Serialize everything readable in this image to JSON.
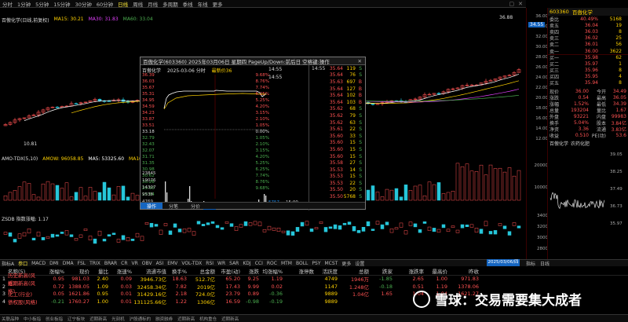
{
  "stock": {
    "code": "603360",
    "name": "百傲化学"
  },
  "topbar": {
    "tabs": [
      "分时",
      "1分钟",
      "5分钟",
      "15分钟",
      "30分钟",
      "60分钟",
      "日线",
      "周线",
      "月线",
      "多周期",
      "季线",
      "年线",
      "更多"
    ],
    "active": "日线"
  },
  "main": {
    "title": "百傲化学(日线,前复权)",
    "ma": {
      "ma15": "MA15: 30.21",
      "ma30": "MA30: 31.83",
      "ma60": "MA60: 33.04"
    },
    "high_label": "36.88",
    "price_tag": "34.55",
    "low_label": "10.81",
    "price_ticks": [
      "36.00",
      "34.00",
      "32.00",
      "30.00",
      "28.00",
      "26.00",
      "24.00",
      "22.00",
      "20.00",
      "18.00",
      "16.00",
      "14.00",
      "12.00"
    ],
    "vol_legend": {
      "name": "AMO-TDX(5,10)",
      "amow": "AMOW: 96058.85",
      "ma5": "MA5: 53325.60",
      "ma10": "MA10: 54237.05"
    },
    "vol_ticks": [
      "20000",
      "10000"
    ],
    "sub_legend": "ZSDB  指数涨幅: 1.17",
    "sub_ticks": [
      "3400",
      "3200",
      "3000",
      "2800"
    ]
  },
  "side": {
    "quotes": [
      {
        "k": "委比",
        "v": "40.49%",
        "n": "委差",
        "nv": "5168"
      },
      {
        "k": "卖五",
        "v": "36.04",
        "n": "",
        "nv": "19"
      },
      {
        "k": "卖四",
        "v": "36.03",
        "n": "",
        "nv": "8"
      },
      {
        "k": "卖三",
        "v": "36.02",
        "n": "",
        "nv": "25"
      },
      {
        "k": "卖二",
        "v": "36.01",
        "n": "",
        "nv": "56"
      },
      {
        "k": "卖一",
        "v": "36.00",
        "n": "",
        "nv": "3622"
      },
      {
        "k": "买一",
        "v": "35.98",
        "n": "",
        "nv": "62"
      },
      {
        "k": "买二",
        "v": "35.97",
        "n": "",
        "nv": "1"
      },
      {
        "k": "买三",
        "v": "35.96",
        "n": "",
        "nv": "8"
      },
      {
        "k": "买四",
        "v": "35.95",
        "n": "",
        "nv": "4"
      },
      {
        "k": "买五",
        "v": "35.94",
        "n": "",
        "nv": "8"
      }
    ],
    "info": [
      {
        "k": "现价",
        "v": "36.00",
        "k2": "今开",
        "v2": "34.49"
      },
      {
        "k": "涨跌",
        "v": "0.54",
        "k2": "最高",
        "v2": "36.05"
      },
      {
        "k": "涨幅",
        "v": "1.52%",
        "k2": "最低",
        "v2": "34.39"
      },
      {
        "k": "总量",
        "v": "193204",
        "k2": "量比",
        "v2": "1.67"
      },
      {
        "k": "外盘",
        "v": "93221",
        "k2": "内盘",
        "v2": "99983"
      },
      {
        "k": "换手",
        "v": "5.04%",
        "k2": "股本",
        "v2": "3.84亿"
      },
      {
        "k": "净资",
        "v": "3.36",
        "k2": "流通",
        "v2": "3.83亿"
      },
      {
        "k": "收益",
        "v": "0.510",
        "k2": "PE(动)",
        "v2": "53.6"
      }
    ],
    "mini_tabs": [
      "百傲化学",
      "农药化肥"
    ],
    "mini_ticks": [
      "39.05",
      "38.25",
      "37.49",
      "36.73",
      "35.97"
    ]
  },
  "popup": {
    "title": "百傲化学(603360)  2025年03月06日 星期四  PageUp/Down:前后日  空格键:操作",
    "sub": {
      "name": "百傲化学",
      "date": "2025-03-06 分时",
      "price": "最新价36"
    },
    "left_ticks": [
      "36.39",
      "36.03",
      "35.67",
      "35.31",
      "34.95",
      "34.59",
      "34.23",
      "33.87",
      "33.51",
      "33.18",
      "32.79",
      "32.43",
      "32.07",
      "31.71",
      "31.35",
      "30.98",
      "30.62",
      "30.26",
      "29.90",
      "29.54"
    ],
    "pct_ticks": [
      "9.68%",
      "8.76%",
      "7.74%",
      "6.25%",
      "5.25%",
      "4.20%",
      "3.15%",
      "2.10%",
      "1.05%",
      "0.00%",
      "1.05%",
      "2.10%",
      "3.15%",
      "4.20%",
      "5.25%",
      "6.25%",
      "7.74%",
      "8.76%",
      "9.68%"
    ],
    "vol_ticks": [
      "23845",
      "19076",
      "14307",
      "9538",
      "4769"
    ],
    "time_labels": [
      "09:30",
      "11:25",
      "13:00",
      "15:00"
    ],
    "cur_time": "14:55",
    "cur_time2": "14:55",
    "trades": [
      {
        "tm": "14:55",
        "pr": "35.64",
        "vv": "119",
        "bs": "S"
      },
      {
        "tm": "",
        "pr": "35.64",
        "vv": "76",
        "bs": "S"
      },
      {
        "tm": "",
        "pr": "35.63",
        "vv": "697",
        "bs": "B"
      },
      {
        "tm": "",
        "pr": "35.64",
        "vv": "127",
        "bs": "B"
      },
      {
        "tm": "",
        "pr": "35.64",
        "vv": "102",
        "bs": "B"
      },
      {
        "tm": "",
        "pr": "35.64",
        "vv": "103",
        "bs": "B"
      },
      {
        "tm": "",
        "pr": "35.62",
        "vv": "68",
        "bs": "S"
      },
      {
        "tm": "",
        "pr": "35.62",
        "vv": "79",
        "bs": "S"
      },
      {
        "tm": "",
        "pr": "35.62",
        "vv": "63",
        "bs": "S"
      },
      {
        "tm": "",
        "pr": "35.61",
        "vv": "22",
        "bs": "S"
      },
      {
        "tm": "",
        "pr": "35.60",
        "vv": "33",
        "bs": "S"
      },
      {
        "tm": "",
        "pr": "35.60",
        "vv": "15",
        "bs": "S"
      },
      {
        "tm": "",
        "pr": "35.60",
        "vv": "15",
        "bs": "S"
      },
      {
        "tm": "",
        "pr": "35.60",
        "vv": "15",
        "bs": "S"
      },
      {
        "tm": "",
        "pr": "35.58",
        "vv": "27",
        "bs": "S"
      },
      {
        "tm": "",
        "pr": "35.53",
        "vv": "14",
        "bs": "S"
      },
      {
        "tm": "",
        "pr": "35.53",
        "vv": "15",
        "bs": "S"
      },
      {
        "tm": "",
        "pr": "35.53",
        "vv": "22",
        "bs": "S"
      },
      {
        "tm": "",
        "pr": "35.50",
        "vv": "20",
        "bs": "S"
      },
      {
        "tm": "",
        "pr": "35.50",
        "vv": "5768",
        "bs": "S"
      }
    ],
    "tabs": [
      "操作",
      "分笔",
      "分价"
    ],
    "bottom_left": "15:00",
    "bottom_vol": "5757"
  },
  "tabstrip": {
    "items": [
      "指标A",
      "参口",
      "MACD",
      "DMI",
      "DMA",
      "FSL",
      "TRIX",
      "BRAR",
      "CR",
      "VR",
      "OBV",
      "ASI",
      "EMV",
      "VOL-TDX",
      "RSI",
      "WR",
      "SAR",
      "KDJ",
      "CCI",
      "ROC",
      "MTM",
      "BOLL",
      "PSY",
      "MCST",
      "更多",
      "设置"
    ],
    "right": [
      "指标",
      "日线"
    ],
    "date": "2025/03/06/四"
  },
  "table": {
    "headers": [
      "",
      "名称(5)",
      "涨幅%",
      "现价",
      "量比",
      "涨速%",
      "流通市值",
      "换手%",
      "总金额",
      "市盈(动)",
      "涨跌",
      "均涨幅%",
      "涨停数",
      "",
      "总额",
      "",
      "总分",
      "活跃度",
      "涨家",
      "跌家",
      "涨跌率",
      "最高价",
      "市值",
      "昨收"
    ],
    "rows": [
      [
        "1",
        "历史新高(风格)",
        "0.95",
        "981.03",
        "2.40",
        "0.09",
        "3946.73亿",
        "18.63",
        "512.7亿",
        "65.20",
        "9.25",
        "1.19",
        "",
        "4749",
        "1946万",
        "-1.85",
        "2.65",
        "1.00",
        "971.83"
      ],
      [
        "2",
        "近期新高(风格)",
        "0.72",
        "1388.05",
        "1.09",
        "0.03",
        "32458.34亿",
        "7.82",
        "2019亿",
        "17.43",
        "9.99",
        "0.02",
        "",
        "1147",
        "1.248亿",
        "-0.18",
        "0.51",
        "1.19",
        "1378.06"
      ],
      [
        "3",
        "化工(行业)",
        "0.05",
        "1621.86",
        "0.95",
        "0.01",
        "31429.16亿",
        "2.18",
        "724.0亿",
        "23.79",
        "0.89",
        "-0.36",
        "",
        "9889",
        "1.04亿",
        "1.65",
        "1.04",
        "1.04",
        "1621.27"
      ],
      [
        "4",
        "债权股(风格)",
        "-0.21",
        "1760.27",
        "1.00",
        "0.01",
        "131125.66亿",
        "1.22",
        "1306亿",
        "16.59",
        "-0.98",
        "-0.19",
        "",
        "9889",
        "",
        "",
        "",
        "",
        ""
      ]
    ]
  },
  "statusbar": [
    "关联品种",
    "中小板指",
    "创业板指",
    "辽宁板块",
    "近期新高",
    "光刻机",
    "沪股通标的",
    "融资融券",
    "近期新高",
    "机构重仓",
    "近期新高"
  ],
  "watermark": "雪球：交易需要集大成者",
  "colors": {
    "up": "#ff5252",
    "down": "#4caf50",
    "accent": "#ffd200",
    "select": "#1565c0"
  }
}
